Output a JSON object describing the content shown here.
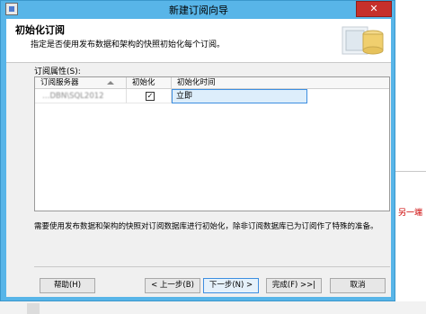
{
  "window": {
    "title": "新建订阅向导",
    "close_label": "✕"
  },
  "header": {
    "title": "初始化订阅",
    "subtitle": "指定是否使用发布数据和架构的快照初始化每个订阅。"
  },
  "subscription_properties": {
    "label": "订阅属性(S):",
    "columns": [
      "订阅服务器",
      "初始化",
      "初始化时间"
    ],
    "rows": [
      {
        "server": "…DBN\\SQL2012",
        "initialize": true,
        "init_time": "立即"
      }
    ]
  },
  "note": "需要使用发布数据和架构的快照对订阅数据库进行初始化，除非订阅数据库已为订阅作了特殊的准备。",
  "buttons": {
    "help": "帮助(H)",
    "prev": "< 上一步(B)",
    "next": "下一步(N) >",
    "finish": "完成(F) >>|",
    "cancel": "取消"
  },
  "background": {
    "right_text": "另一端"
  },
  "colors": {
    "titlebar": "#58b5e8",
    "close_button": "#c6302b",
    "selection": "#3d8ee0"
  }
}
